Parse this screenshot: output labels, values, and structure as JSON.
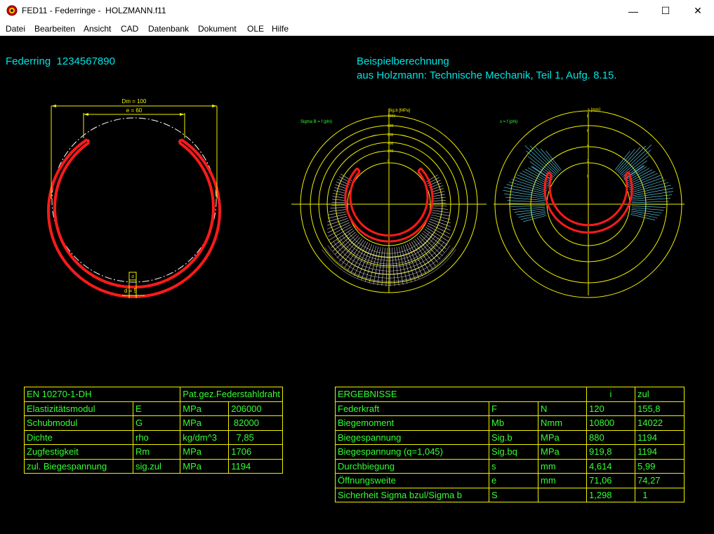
{
  "window": {
    "title": "FED11 - Federringe -  HOLZMANN.f11",
    "minimize": "—",
    "maximize": "☐",
    "close": "✕"
  },
  "menu": [
    "Datei",
    "Bearbeiten",
    "Ansicht",
    "CAD",
    "Datenbank",
    "Dokument",
    "OLE",
    "Hilfe"
  ],
  "header": {
    "part_title": "Federring  1234567890",
    "example_line1": "Beispielberechnung",
    "example_line2": "aus Holzmann: Technische Mechanik, Teil 1, Aufg. 8.15."
  },
  "drawing": {
    "dim_dm": "Dm = 100",
    "dim_e": "e = 60",
    "dim_d": "d = 5",
    "dim_d_small": "d"
  },
  "chart_sigma": {
    "label": "Sigma B = f (phi)",
    "axis_label": "Sig.b [MPa]",
    "ticks": [
      "1000",
      "800",
      "600",
      "400",
      "200",
      "0"
    ]
  },
  "chart_s": {
    "label": "s = f (phi)",
    "axis_label": "s [mm]",
    "ticks": [
      "8",
      "6",
      "4",
      "2",
      "0"
    ]
  },
  "material_table": {
    "header": [
      "EN 10270-1-DH",
      "Pat.gez.Federstahldraht"
    ],
    "rows": [
      [
        "Elastizitätsmodul",
        "E",
        "MPa",
        "206000"
      ],
      [
        "Schubmodul",
        "G",
        "MPa",
        " 82000"
      ],
      [
        "Dichte",
        "rho",
        "kg/dm^3",
        "  7,85"
      ],
      [
        "Zugfestigkeit",
        "Rm",
        "MPa",
        "1706"
      ],
      [
        "zul. Biegespannung",
        "sig.zul",
        "MPa",
        "1194"
      ]
    ]
  },
  "results_table": {
    "header": [
      "ERGEBNISSE",
      "",
      "",
      "i",
      "zul"
    ],
    "rows": [
      [
        "Federkraft",
        "F",
        "N",
        "120",
        "155,8"
      ],
      [
        "Biegemoment",
        "Mb",
        "Nmm",
        "10800",
        "14022"
      ],
      [
        "Biegespannung",
        "Sig.b",
        "MPa",
        "880",
        "1194"
      ],
      [
        "Biegespannung (q=1,045)",
        "Sig.bq",
        "MPa",
        "919,8",
        "1194"
      ],
      [
        "Durchbiegung",
        "s",
        "mm",
        "4,614",
        "5,99"
      ],
      [
        "Öffnungsweite",
        "e",
        "mm",
        "71,06",
        "74,27"
      ],
      [
        "Sicherheit Sigma bzul/Sigma b",
        "S",
        "",
        "1,298",
        "  1"
      ]
    ]
  },
  "colors": {
    "background": "#000000",
    "ring": "#ff1a1a",
    "dimension": "#f0f000",
    "table_text": "#33ff33",
    "header_text": "#00e5e5",
    "stress_hatch": "#d8d8d8",
    "deflection_hatch": "#66e0ff"
  }
}
